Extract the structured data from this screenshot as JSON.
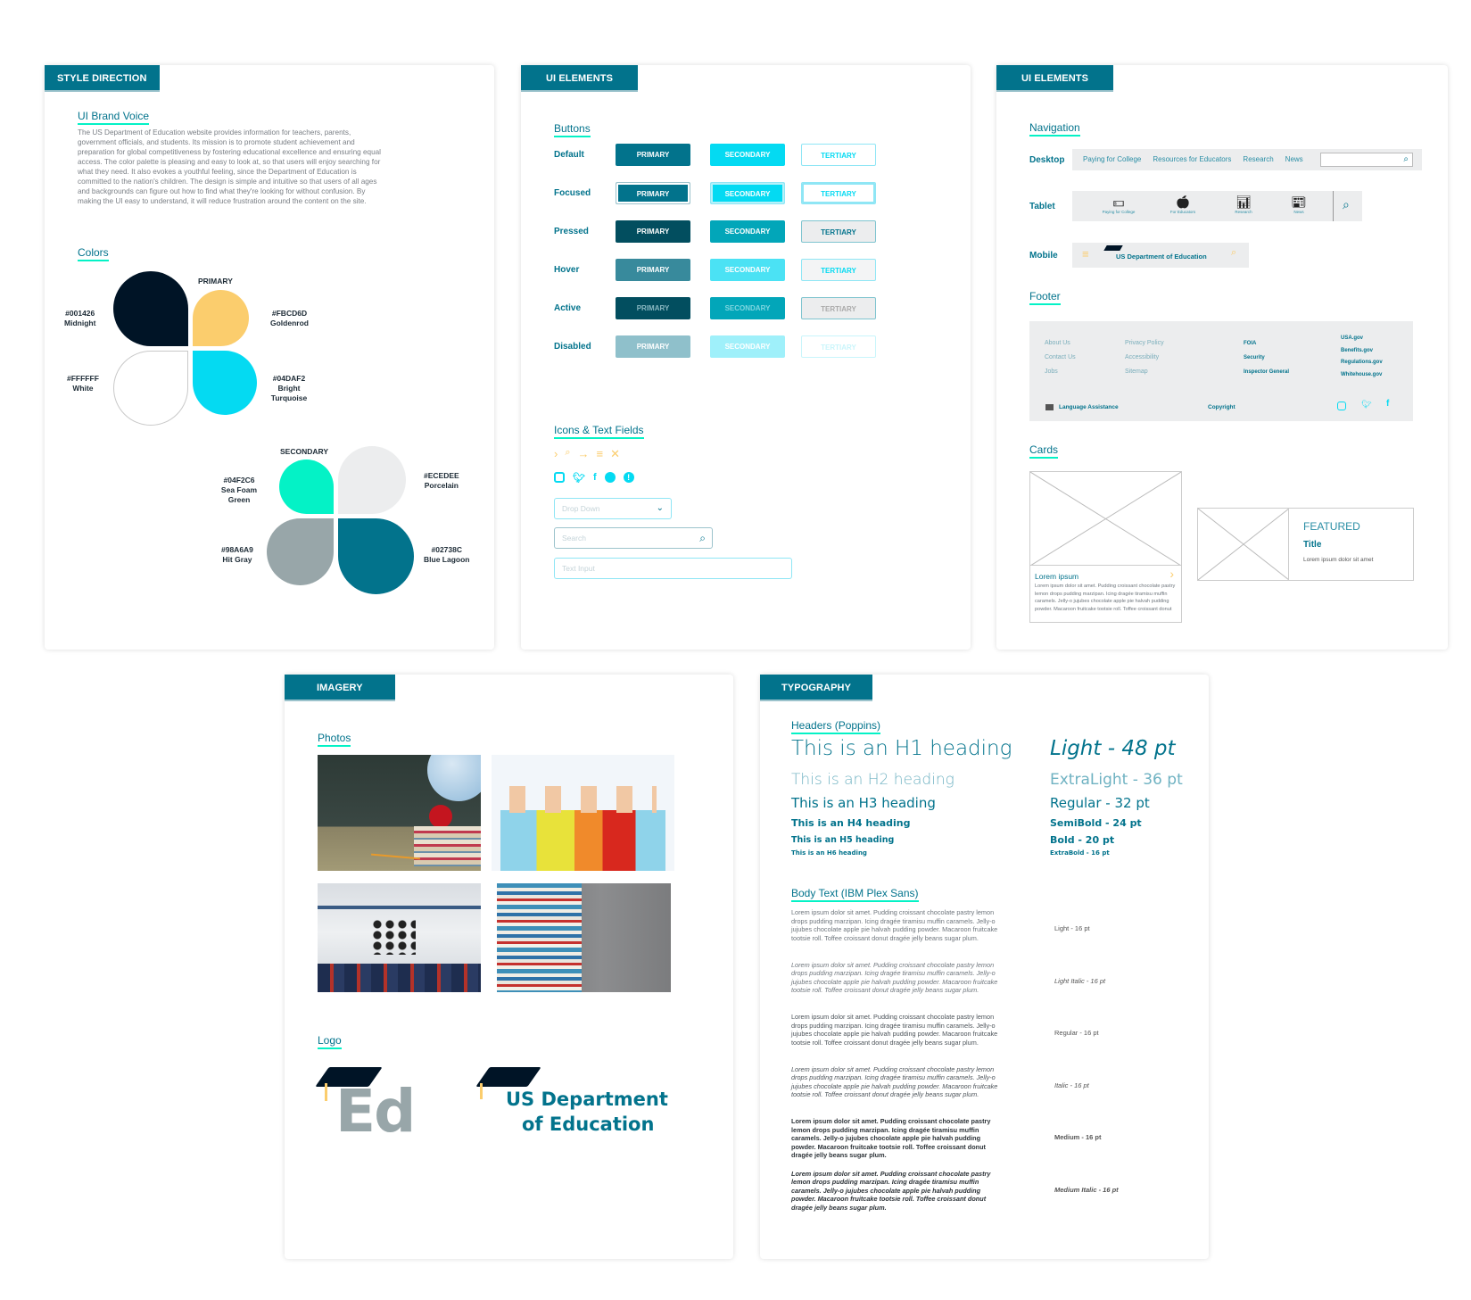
{
  "style_direction": {
    "tab": "STYLE DIRECTION",
    "brand_voice_title": "UI Brand Voice",
    "brand_voice_text": "The US Department of Education website provides information for teachers, parents, government officials, and students. Its mission is to promote student achievement and preparation for global competitiveness by fostering educational excellence and ensuring equal access. The color palette is pleasing and easy to look at, so that users will enjoy searching for what they need. It also evokes a youthful feeling, since the Department of Education is committed to the nation's children. The design is simple and intuitive so that users of all ages and backgrounds can figure out how to find what they're looking for without confusion. By making the UI easy to understand, it will reduce frustration around the content on the site.",
    "colors_title": "Colors",
    "primary_label": "PRIMARY",
    "secondary_label": "SECONDARY",
    "primary": [
      {
        "hex": "#001426",
        "name": "Midnight"
      },
      {
        "hex": "#FBCD6D",
        "name": "Goldenrod"
      },
      {
        "hex": "#FFFFFF",
        "name": "White"
      },
      {
        "hex": "#04DAF2",
        "name": "Bright Turquoise"
      }
    ],
    "secondary": [
      {
        "hex": "#04F2C6",
        "name": "Sea Foam Green"
      },
      {
        "hex": "#ECEDEE",
        "name": "Porcelain"
      },
      {
        "hex": "#98A6A9",
        "name": "Hit Gray"
      },
      {
        "hex": "#02738C",
        "name": "Blue Lagoon"
      }
    ]
  },
  "ui_elements_1": {
    "tab": "UI ELEMENTS",
    "buttons_title": "Buttons",
    "states": [
      "Default",
      "Focused",
      "Pressed",
      "Hover",
      "Active",
      "Disabled"
    ],
    "primary_label": "PRIMARY",
    "secondary_label": "SECONDARY",
    "tertiary_label": "TERTIARY",
    "icons_title": "Icons & Text Fields",
    "dropdown_placeholder": "Drop Down",
    "search_placeholder": "Search",
    "text_input_placeholder": "Text Input"
  },
  "ui_elements_2": {
    "tab": "UI ELEMENTS",
    "navigation_title": "Navigation",
    "desktop_label": "Desktop",
    "desktop_links": [
      "Paying for College",
      "Resources for Educators",
      "Research",
      "News"
    ],
    "tablet_label": "Tablet",
    "tablet_links": [
      "Paying for College",
      "For Educators",
      "Research",
      "News"
    ],
    "mobile_label": "Mobile",
    "mobile_brand": "US Department of Education",
    "footer_title": "Footer",
    "footer_col1": [
      "About Us",
      "Contact Us",
      "Jobs"
    ],
    "footer_col2": [
      "Privacy Policy",
      "Accessibility",
      "Sitemap"
    ],
    "footer_col3": [
      "FOIA",
      "Security",
      "Inspector General"
    ],
    "footer_col4": [
      "USA.gov",
      "Benefits.gov",
      "Regulations.gov",
      "Whitehouse.gov"
    ],
    "language": "Language Assistance",
    "copyright": "Copyright",
    "cards_title": "Cards",
    "card_title": "Lorem ipsum",
    "card_text": "Lorem ipsum dolor sit amet. Pudding croissant chocolate pastry lemon drops pudding marzipan. Icing dragée tiramisu muffin caramels. Jelly-o jujubes chocolate apple pie halvah pudding powder. Macaroon fruitcake tootsie roll. Toffee croissant donut",
    "featured_label": "FEATURED",
    "featured_title": "Title",
    "featured_text": "Lorem ipsum dolor sit amet"
  },
  "imagery": {
    "tab": "IMAGERY",
    "photos_title": "Photos",
    "logo_title": "Logo",
    "logo_short": "Ed",
    "logo_line1": "US Department",
    "logo_line2": "of Education"
  },
  "typography": {
    "tab": "TYPOGRAPHY",
    "headers_title": "Headers (Poppins)",
    "headings": [
      {
        "text": "This is an H1 heading",
        "spec": "Light - 48 pt"
      },
      {
        "text": "This is an H2 heading",
        "spec": "ExtraLight - 36 pt"
      },
      {
        "text": "This is an H3 heading",
        "spec": "Regular - 32 pt"
      },
      {
        "text": "This is an H4 heading",
        "spec": "SemiBold - 24 pt"
      },
      {
        "text": "This is an H5 heading",
        "spec": "Bold - 20 pt"
      },
      {
        "text": "This is an H6 heading",
        "spec": "ExtraBold - 16 pt"
      }
    ],
    "body_title": "Body Text (IBM Plex Sans)",
    "body_sample": "Lorem ipsum dolor sit amet. Pudding croissant chocolate pastry lemon drops pudding marzipan. Icing dragée tiramisu muffin caramels. Jelly-o jujubes chocolate apple pie halvah pudding powder. Macaroon fruitcake tootsie roll. Toffee croissant donut dragée jelly beans sugar plum.",
    "body_specs": [
      "Light - 16 pt",
      "Light Italic - 16 pt",
      "Regular - 16 pt",
      "Italic - 16 pt",
      "Medium - 16 pt",
      "Medium Italic - 16 pt"
    ]
  }
}
